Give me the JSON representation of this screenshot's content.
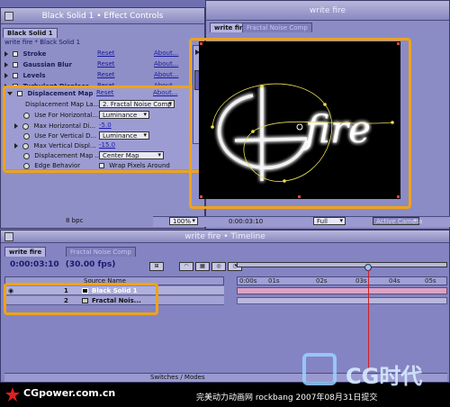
{
  "effect_controls": {
    "title": "Black Solid 1 • Effect Controls",
    "tab_label": "Black Solid 1",
    "breadcrumb": "write fire * Black Solid 1",
    "effects": [
      {
        "name": "Stroke",
        "reset": "Reset",
        "about": "About..."
      },
      {
        "name": "Gaussian Blur",
        "reset": "Reset",
        "about": "About..."
      },
      {
        "name": "Levels",
        "reset": "Reset",
        "about": "About..."
      },
      {
        "name": "Turbulent Displace",
        "reset": "Reset",
        "about": "About..."
      }
    ],
    "displacement": {
      "name": "Displacement Map",
      "reset": "Reset",
      "about": "About...",
      "rows": [
        {
          "label": "Displacement Map La...",
          "value": "2. Fractal Noise Comp"
        },
        {
          "label": "Use For Horizontal...",
          "value": "Luminance"
        },
        {
          "label": "Max Horizontal Di...",
          "value": "-5.0"
        },
        {
          "label": "Use For Vertical D...",
          "value": "Luminance"
        },
        {
          "label": "Max Vertical Displ...",
          "value": "-15.0"
        },
        {
          "label": "Displacement Map ...",
          "value": "Center Map"
        },
        {
          "label": "Edge Behavior",
          "value": "Wrap Pixels Around"
        }
      ]
    },
    "color_depth": "8 bpc"
  },
  "comp": {
    "title": "write fire",
    "tabs": [
      "write fire",
      "Fractal Noise Comp"
    ],
    "zoom": "100%",
    "timecode": "0:00:03:10",
    "resolution": "Full",
    "camera": "Active Camera",
    "canvas_text": "fire"
  },
  "timeline": {
    "title": "write fire • Timeline",
    "tabs": [
      "write fire",
      "Fractal Noise Comp"
    ],
    "timecode": "0:00:03:10",
    "fps": "(30.00 fps)",
    "column_header": "Source Name",
    "layers": [
      {
        "num": "1",
        "name": "Black Solid 1"
      },
      {
        "num": "2",
        "name": "Fractal Nois..."
      }
    ],
    "ruler": [
      "0:00s",
      "01s",
      "02s",
      "03s",
      "04s",
      "05s"
    ],
    "footer": "Switches / Modes"
  },
  "watermark": {
    "brand": "CGpower.com.cn",
    "right_logo": "CG时代",
    "caption": "完美动力动画网 rockbang 2007年08月31日提交"
  },
  "colors": {
    "highlight": "#f0a318",
    "window_bg": "#8f8fc8",
    "canvas": "#000000",
    "playhead": "#cc2222",
    "layer_bar": "#d9a3c8"
  }
}
